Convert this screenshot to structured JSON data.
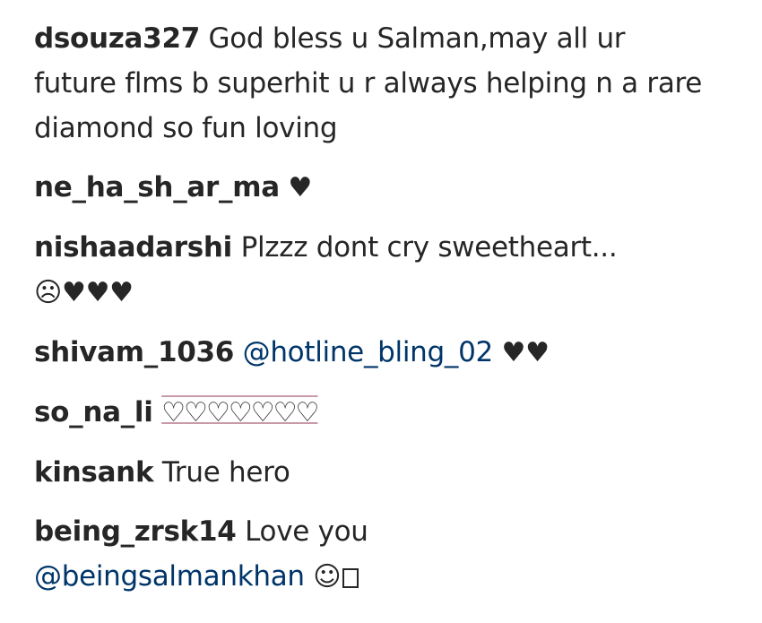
{
  "comments": [
    {
      "username": "dsouza327",
      "text": "God bless u Salman,may all ur future flms b superhit u r always helping n a rare diamond so fun loving"
    },
    {
      "username": "ne_ha_sh_ar_ma",
      "text": "♥"
    },
    {
      "username": "nishaadarshi",
      "text": "Plzzz dont cry sweetheart...",
      "emoji": "☹♥♥♥"
    },
    {
      "username": "shivam_1036",
      "mention": "@hotline_bling_02",
      "text": "♥♥"
    },
    {
      "username": "so_na_li",
      "text": "♡♡♡♡♡♡♡"
    },
    {
      "username": "kinsank",
      "text": "True hero"
    },
    {
      "username": "being_zrsk14",
      "text": "Love you",
      "mention": "@beingsalmankhan",
      "emoji": "☺"
    }
  ]
}
